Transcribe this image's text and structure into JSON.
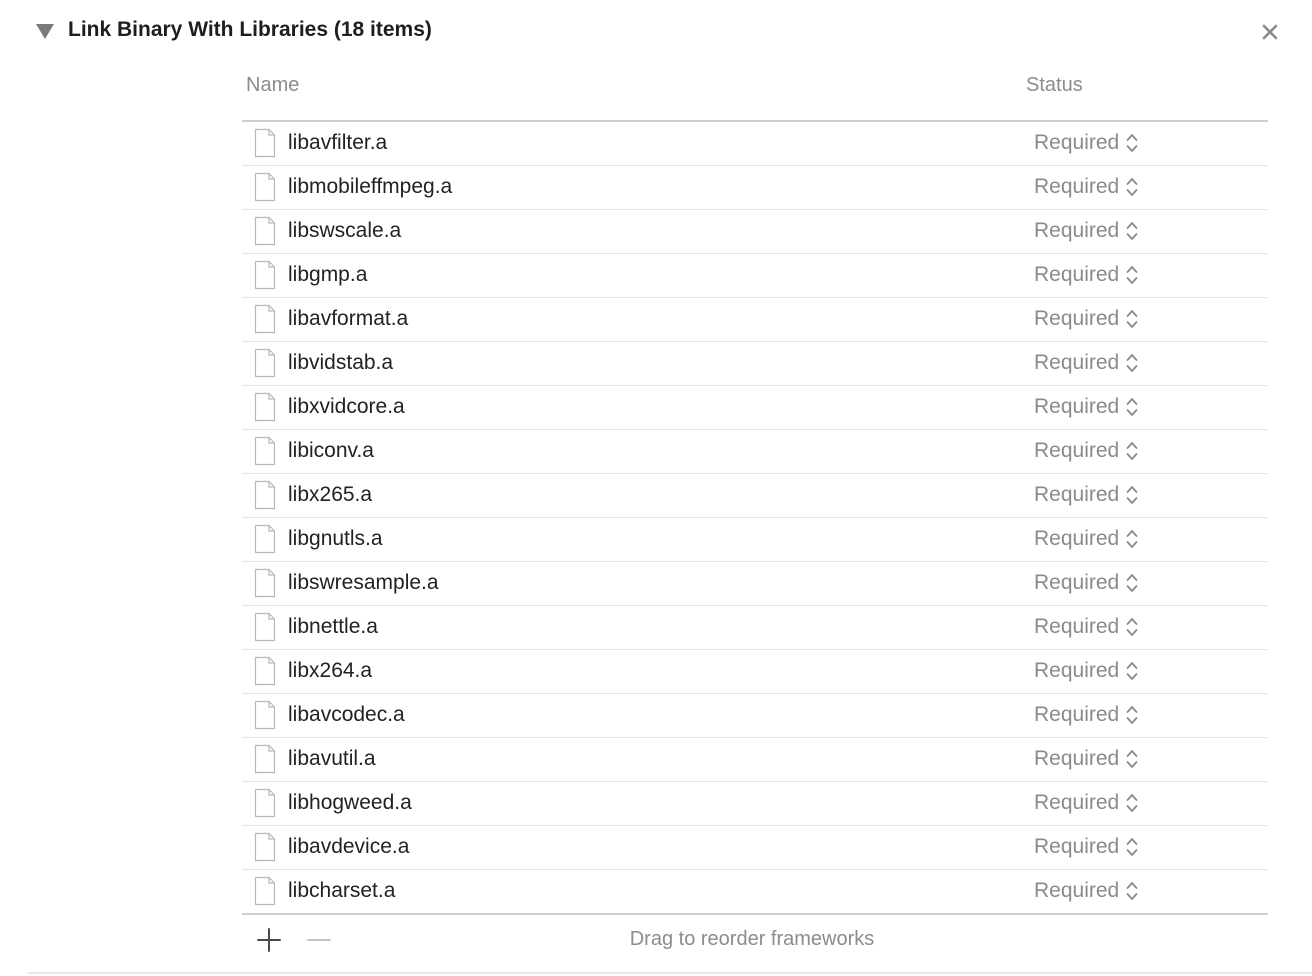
{
  "phase": {
    "title": "Link Binary With Libraries (18 items)",
    "disclosure_icon": "disclosure-triangle-down-icon",
    "close_icon": "close-icon"
  },
  "columns": {
    "name": "Name",
    "status": "Status"
  },
  "libraries": [
    {
      "name": "libavfilter.a",
      "status": "Required"
    },
    {
      "name": "libmobileffmpeg.a",
      "status": "Required"
    },
    {
      "name": "libswscale.a",
      "status": "Required"
    },
    {
      "name": "libgmp.a",
      "status": "Required"
    },
    {
      "name": "libavformat.a",
      "status": "Required"
    },
    {
      "name": "libvidstab.a",
      "status": "Required"
    },
    {
      "name": "libxvidcore.a",
      "status": "Required"
    },
    {
      "name": "libiconv.a",
      "status": "Required"
    },
    {
      "name": "libx265.a",
      "status": "Required"
    },
    {
      "name": "libgnutls.a",
      "status": "Required"
    },
    {
      "name": "libswresample.a",
      "status": "Required"
    },
    {
      "name": "libnettle.a",
      "status": "Required"
    },
    {
      "name": "libx264.a",
      "status": "Required"
    },
    {
      "name": "libavcodec.a",
      "status": "Required"
    },
    {
      "name": "libavutil.a",
      "status": "Required"
    },
    {
      "name": "libhogweed.a",
      "status": "Required"
    },
    {
      "name": "libavdevice.a",
      "status": "Required"
    },
    {
      "name": "libcharset.a",
      "status": "Required"
    }
  ],
  "footer": {
    "hint": "Drag to reorder frameworks",
    "add_icon": "plus-icon",
    "remove_icon": "minus-icon"
  }
}
